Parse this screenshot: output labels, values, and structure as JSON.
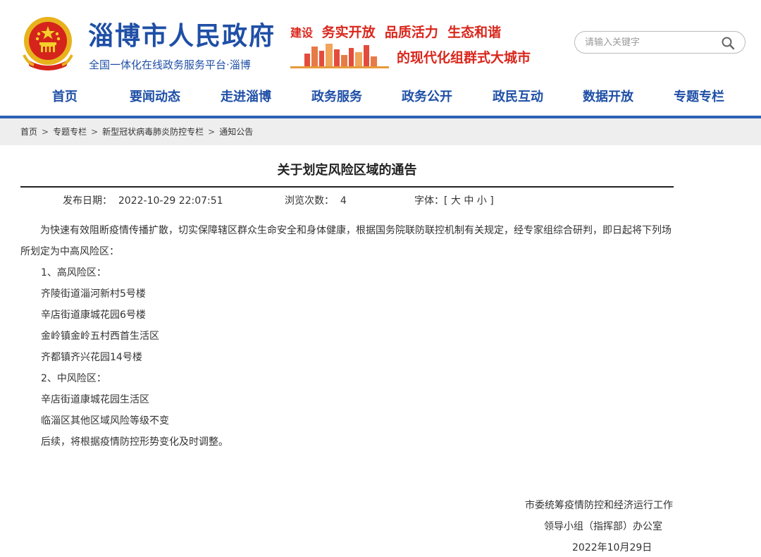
{
  "header": {
    "site_title": "淄博市人民政府",
    "site_subtitle": "全国一体化在线政务服务平台·淄博",
    "slogan_prefix": "建设",
    "slogan_line1": "务实开放  品质活力  生态和谐",
    "slogan_line2": "的现代化组群式大城市",
    "brand_color": "#1f4fa6",
    "slogan_color": "#d9261c"
  },
  "search": {
    "placeholder": "请输入关键字",
    "icon": "search-icon"
  },
  "nav": {
    "items": [
      "首页",
      "要闻动态",
      "走进淄博",
      "政务服务",
      "政务公开",
      "政民互动",
      "数据开放",
      "专题专栏"
    ]
  },
  "breadcrumb": {
    "items": [
      "首页",
      "专题专栏",
      "新型冠状病毒肺炎防控专栏",
      "通知公告"
    ],
    "separator": ">"
  },
  "article": {
    "title": "关于划定风险区域的通告",
    "meta": {
      "publish_date": "发布日期：  2022-10-29 22:07:51",
      "views": "浏览次数：  4",
      "font_size": "字体：[ 大 中 小 ]"
    },
    "intro_line1": "为快速有效阻断疫情传播扩散，切实保障辖区群众生命安全和身体健康，根据国务院联防联控机制有关规定，经专家组综合研判，即日起将下列场",
    "intro_line2": "所划定为中高风险区：",
    "lines": [
      "1、高风险区：",
      "齐陵街道淄河新村5号楼",
      "辛店街道康城花园6号楼",
      "金岭镇金岭五村西首生活区",
      "齐都镇齐兴花园14号楼",
      "2、中风险区：",
      "辛店街道康城花园生活区",
      "临淄区其他区域风险等级不变",
      "后续，将根据疫情防控形势变化及时调整。"
    ],
    "signature": {
      "org_line1": "市委统筹疫情防控和经济运行工作",
      "org_line2": "领导小组（指挥部）办公室",
      "date": "2022年10月29日"
    }
  }
}
